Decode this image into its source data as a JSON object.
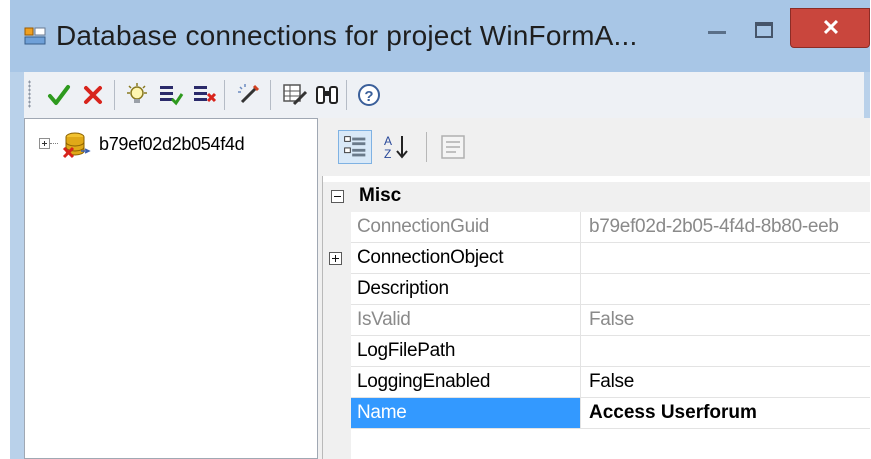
{
  "window": {
    "title": "Database connections for project WinFormA...",
    "minimize_icon": "minimize-icon",
    "maximize_icon": "maximize-icon",
    "close_icon": "close-icon",
    "close_glyph": "✕"
  },
  "toolbar": {
    "buttons": [
      {
        "name": "ok-check-icon"
      },
      {
        "name": "cancel-x-icon"
      },
      {
        "name": "lightbulb-icon"
      },
      {
        "name": "list-check-icon"
      },
      {
        "name": "list-delete-icon"
      },
      {
        "name": "magic-wand-icon"
      },
      {
        "name": "wizard-grid-icon"
      },
      {
        "name": "binoculars-icon"
      },
      {
        "name": "help-icon"
      }
    ]
  },
  "tree": {
    "items": [
      {
        "label": "b79ef02d2b054f4d",
        "icon": "database-error-icon",
        "expanded": false
      }
    ]
  },
  "property_grid": {
    "toolbar": [
      {
        "name": "categorized-icon",
        "active": true
      },
      {
        "name": "alphabetical-icon",
        "active": false
      },
      {
        "name": "property-pages-icon",
        "active": false
      }
    ],
    "category": "Misc",
    "rows": [
      {
        "name": "ConnectionGuid",
        "value": "b79ef02d-2b05-4f4d-8b80-eeb",
        "readonly": true
      },
      {
        "name": "ConnectionObject",
        "value": "",
        "expandable": true
      },
      {
        "name": "Description",
        "value": ""
      },
      {
        "name": "IsValid",
        "value": "False",
        "readonly": true
      },
      {
        "name": "LogFilePath",
        "value": ""
      },
      {
        "name": "LoggingEnabled",
        "value": "False"
      },
      {
        "name": "Name",
        "value": "Access Userforum",
        "selected": true,
        "bold": true
      }
    ]
  },
  "colors": {
    "selection": "#3399ff",
    "close_button": "#c9463d",
    "titlebar": "#a8c6e6",
    "readonly_text": "#8a8a8a"
  }
}
